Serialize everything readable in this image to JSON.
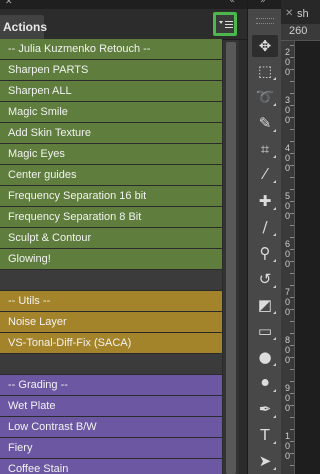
{
  "panel": {
    "tab_label": "Actions",
    "close_glyph": "✕",
    "collapse_glyph": "«"
  },
  "actions": {
    "items": [
      {
        "label": "-- Julia Kuzmenko Retouch --",
        "color": "green"
      },
      {
        "label": "Sharpen PARTS",
        "color": "green"
      },
      {
        "label": "Sharpen ALL",
        "color": "green"
      },
      {
        "label": "Magic Smile",
        "color": "green"
      },
      {
        "label": "Add Skin Texture",
        "color": "green"
      },
      {
        "label": "Magic Eyes",
        "color": "green"
      },
      {
        "label": "Center guides",
        "color": "green"
      },
      {
        "label": "Frequency Separation 16 bit",
        "color": "green"
      },
      {
        "label": "Frequency Separation 8 Bit",
        "color": "green"
      },
      {
        "label": "Sculpt & Contour",
        "color": "green"
      },
      {
        "label": "Glowing!",
        "color": "green"
      },
      {
        "label": "",
        "color": "gap"
      },
      {
        "label": "-- Utils --",
        "color": "gold"
      },
      {
        "label": "Noise Layer",
        "color": "gold"
      },
      {
        "label": "VS-Tonal-Diff-Fix (SACA)",
        "color": "gold"
      },
      {
        "label": "",
        "color": "gap"
      },
      {
        "label": "-- Grading --",
        "color": "purple"
      },
      {
        "label": "Wet Plate",
        "color": "purple"
      },
      {
        "label": "Low Contrast B/W",
        "color": "purple"
      },
      {
        "label": "Fiery",
        "color": "purple"
      },
      {
        "label": "Coffee Stain",
        "color": "purple"
      }
    ]
  },
  "colors": {
    "green": "#5f7d3c",
    "gold": "#a4842b",
    "purple": "#6c58a2",
    "menu_highlight": "#4cb74c"
  },
  "tools": {
    "collapse_glyph": "»",
    "items": [
      {
        "name": "move-tool-icon",
        "glyph": "✥",
        "active": true
      },
      {
        "name": "marquee-tool-icon",
        "glyph": "⬚",
        "active": false
      },
      {
        "name": "lasso-tool-icon",
        "glyph": "➰",
        "active": false
      },
      {
        "name": "quick-selection-tool-icon",
        "glyph": "✎",
        "active": false
      },
      {
        "name": "crop-tool-icon",
        "glyph": "⌗",
        "active": false
      },
      {
        "name": "eyedropper-tool-icon",
        "glyph": "⁄",
        "active": false
      },
      {
        "name": "healing-brush-tool-icon",
        "glyph": "✚",
        "active": false
      },
      {
        "name": "brush-tool-icon",
        "glyph": "∕",
        "active": false
      },
      {
        "name": "clone-stamp-tool-icon",
        "glyph": "⚲",
        "active": false
      },
      {
        "name": "history-brush-tool-icon",
        "glyph": "↺",
        "active": false
      },
      {
        "name": "eraser-tool-icon",
        "glyph": "◩",
        "active": false
      },
      {
        "name": "gradient-tool-icon",
        "glyph": "▭",
        "active": false
      },
      {
        "name": "blur-tool-icon",
        "glyph": "●",
        "active": false
      },
      {
        "name": "dodge-tool-icon",
        "glyph": "⚫",
        "active": false
      },
      {
        "name": "pen-tool-icon",
        "glyph": "✒",
        "active": false
      },
      {
        "name": "type-tool-icon",
        "glyph": "T",
        "active": false
      },
      {
        "name": "path-selection-tool-icon",
        "glyph": "➤",
        "active": false
      }
    ]
  },
  "document": {
    "tab_name": "sh",
    "close_glyph": "✕",
    "ruler_top_value": "260",
    "ruler_left_values": [
      "200",
      "300",
      "400",
      "500",
      "600",
      "700",
      "800",
      "900",
      "100"
    ]
  }
}
